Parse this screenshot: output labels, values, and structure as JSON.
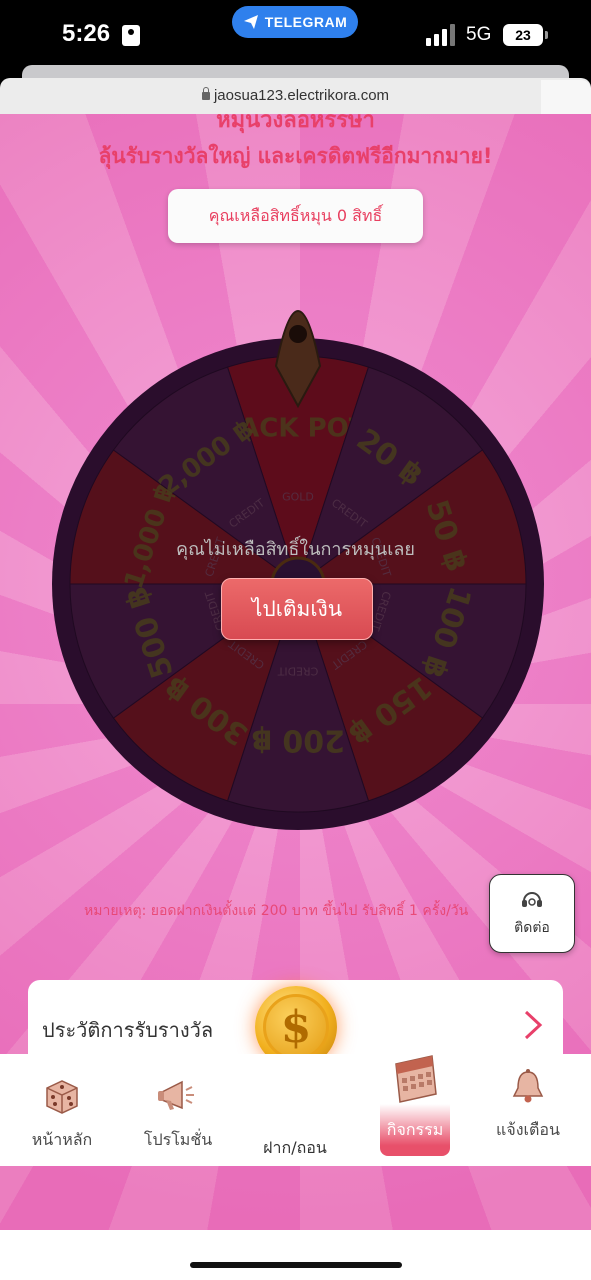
{
  "status_bar": {
    "time": "5:26",
    "pill_label": "TELEGRAM",
    "network": "5G",
    "battery": "23"
  },
  "browser": {
    "url": "jaosua123.electrikora.com"
  },
  "page": {
    "title_top": "หมุนวงล้อหรรษา",
    "title_sub": "ลุ้นรับรางวัลใหญ่ และเครดิตฟรีอีกมากมาย!",
    "spins_remaining": "คุณเหลือสิทธิ์หมุน 0 สิทธิ์",
    "no_spins_text": "คุณไม่เหลือสิทธิ์ในการหมุนเลย",
    "topup_button": "ไปเติมเงิน",
    "note": "หมายเหตุ: ยอดฝากเงินตั้งแต่ 200 บาท ขึ้นไป รับสิทธิ์ 1 ครั้ง/วัน",
    "contact_label": "ติดต่อ",
    "history_label": "ประวัติการรับรางวัล"
  },
  "wheel": {
    "segments": [
      {
        "label": "JACK POT",
        "sub": "GOLD",
        "color": "#7a0f14"
      },
      {
        "label": "20 ฿",
        "sub": "CREDIT",
        "color": "#3c1a3a"
      },
      {
        "label": "50 ฿",
        "sub": "CREDIT",
        "color": "#6e1414"
      },
      {
        "label": "100 ฿",
        "sub": "CREDIT",
        "color": "#3c1a3a"
      },
      {
        "label": "150 ฿",
        "sub": "CREDIT",
        "color": "#6e1414"
      },
      {
        "label": "200 ฿",
        "sub": "CREDIT",
        "color": "#3c1a3a"
      },
      {
        "label": "300 ฿",
        "sub": "CREDIT",
        "color": "#6e1414"
      },
      {
        "label": "500 ฿",
        "sub": "CREDIT",
        "color": "#3c1a3a"
      },
      {
        "label": "1,000 ฿",
        "sub": "CREDIT",
        "color": "#6e1414"
      },
      {
        "label": "2,000 ฿",
        "sub": "CREDIT",
        "color": "#3c1a3a"
      }
    ],
    "rim_color": "#2a0d2c",
    "text_color": "#5a5a14"
  },
  "nav": {
    "home": "หน้าหลัก",
    "promo": "โปรโมชั่น",
    "deposit": "ฝาก/ถอน",
    "activity": "กิจกรรม",
    "notify": "แจ้งเตือน"
  },
  "colors": {
    "accent": "#e8406a",
    "telegram": "#2f80ed",
    "page_pink": "#f08bd0"
  }
}
